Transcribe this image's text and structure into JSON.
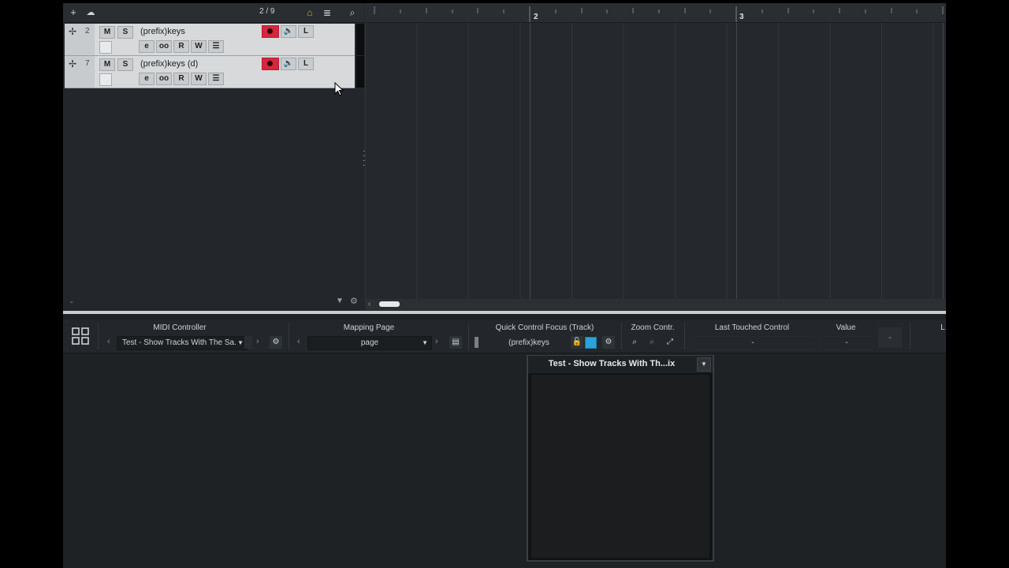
{
  "toolbar": {
    "add_icon": "plus-icon",
    "home_icon": "cloud-icon",
    "counter": "2 / 9",
    "lock_icon": "home-lock-icon",
    "list_icon": "list-icon",
    "search_icon": "search-icon"
  },
  "tracks": [
    {
      "number": "2",
      "name": "(prefix)keys",
      "mute": "M",
      "solo": "S",
      "read": "R",
      "write": "W",
      "edit": "e",
      "link": "oo"
    },
    {
      "number": "7",
      "name": "(prefix)keys (d)",
      "mute": "M",
      "solo": "S",
      "read": "R",
      "write": "W",
      "edit": "e",
      "link": "oo"
    }
  ],
  "ruler": {
    "marker_2": "2",
    "marker_3": "3"
  },
  "tracklist_footer": {
    "dash": "-"
  },
  "lower_zone": {
    "midi_controller_label": "MIDI Controller",
    "midi_controller_value": "Test - Show Tracks With The Sa.",
    "mapping_page_label": "Mapping Page",
    "mapping_page_value": "page",
    "quick_control_label": "Quick Control Focus (Track)",
    "quick_control_value": "(prefix)keys",
    "zoom_label": "Zoom Contr.",
    "last_touched_label": "Last Touched Control",
    "last_touched_value": "-",
    "value_label": "Value",
    "value_value": "-",
    "extra_value": "-",
    "cut_label": "L"
  },
  "panel": {
    "title": "Test - Show Tracks With Th...ix"
  },
  "colors": {
    "record": "#d8263b",
    "accent_blue": "#29a3d9"
  }
}
